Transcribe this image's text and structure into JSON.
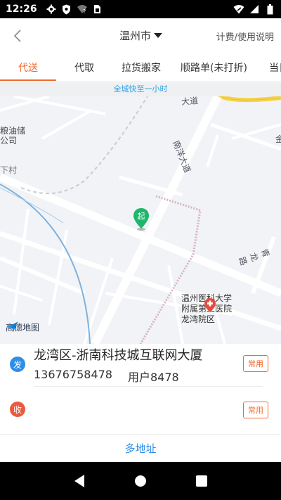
{
  "status_bar": {
    "time": "12:26",
    "left_icons": [
      "gear-icon",
      "shield-icon",
      "wifi-off-icon",
      "sim-card-icon"
    ],
    "right_icons": [
      "wifi-icon",
      "signal-icon",
      "battery-icon"
    ]
  },
  "header": {
    "city": "温州市",
    "help_link": "计费/使用说明"
  },
  "tabs": [
    {
      "label": "代送",
      "active": true
    },
    {
      "label": "代取",
      "active": false
    },
    {
      "label": "拉货搬家",
      "active": false
    },
    {
      "label": "顺路单(未打折)",
      "active": false
    },
    {
      "label": "当日",
      "active": false
    }
  ],
  "map": {
    "banner": "全城快至一小时",
    "start_marker": "起",
    "labels": {
      "nanyang_avenue": "南洋大道",
      "rail_avenue": "大道",
      "poi_left": "粮油储\n公司",
      "village_left": "下村",
      "road_right_1": "青龙路",
      "hospital": "温州医科大学\n附属第二医院\n龙湾院区",
      "right_edge": "金"
    },
    "logo": "高德地图"
  },
  "sender": {
    "badge": "发",
    "address": "龙湾区-浙南科技城互联网大厦",
    "phone": "13676758478",
    "name": "用户8478",
    "common_label": "常用"
  },
  "receiver": {
    "badge": "收",
    "common_label": "常用"
  },
  "multi_address": "多地址",
  "colors": {
    "accent": "#f26a2d",
    "blue": "#2e8ee8",
    "red": "#ea5a3f",
    "marker_green": "#1fb56b"
  }
}
